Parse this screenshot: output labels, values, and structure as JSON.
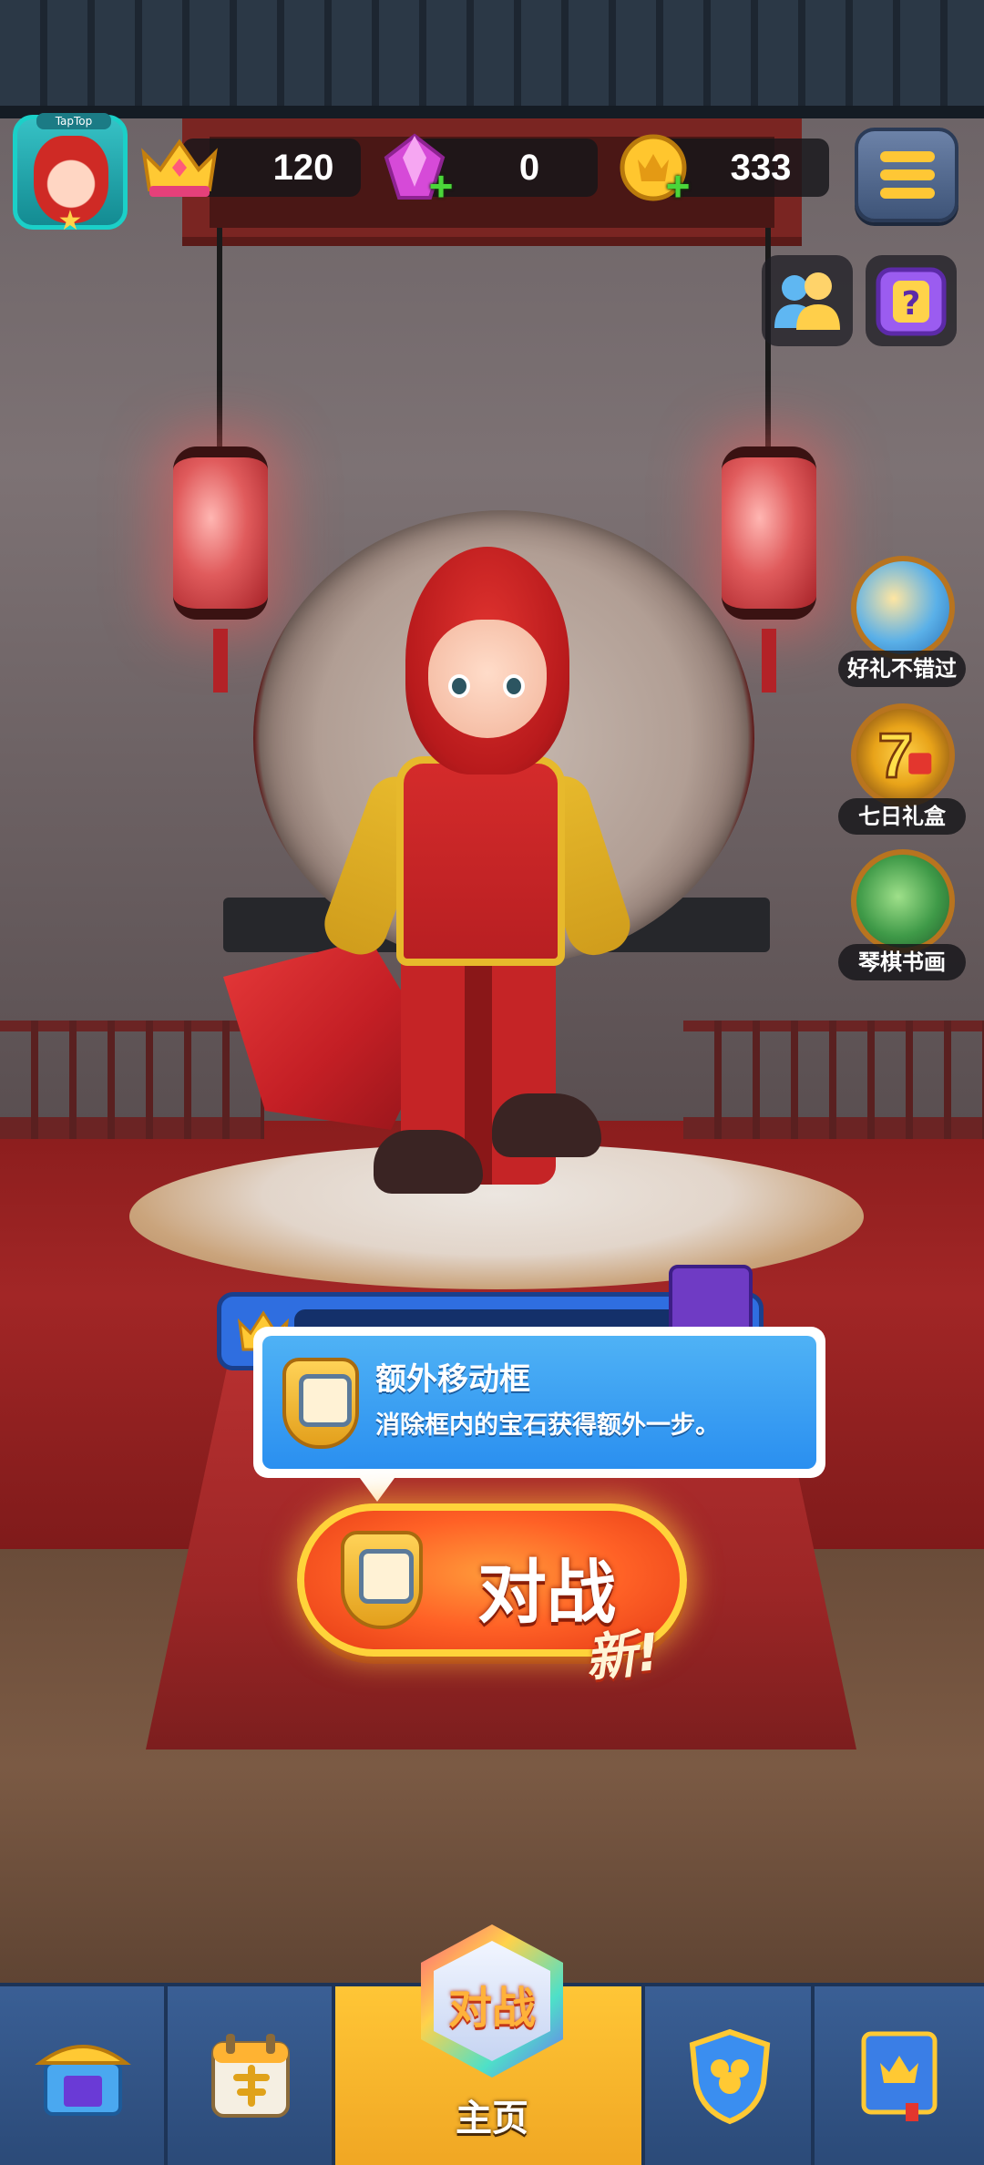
{
  "top_bar": {
    "avatar_tag": "TapTop",
    "crowns": "120",
    "gems": "0",
    "coins": "333"
  },
  "side_events": [
    {
      "label": "好礼不错过",
      "icon": "megaphone-gift-icon"
    },
    {
      "label": "七日礼盒",
      "icon": "seven-day-gift-icon"
    },
    {
      "label": "琴棋书画",
      "icon": "chess-painting-icon"
    }
  ],
  "tooltip": {
    "title": "额外移动框",
    "description": "消除框内的宝石获得额外一步。"
  },
  "battle": {
    "label": "对战",
    "new_badge": "新!"
  },
  "bottom_nav": {
    "home_badge": "对战",
    "home_label": "主页",
    "tabs": [
      {
        "name": "shop",
        "icon": "shop-icon"
      },
      {
        "name": "events",
        "icon": "calendar-icon"
      },
      {
        "name": "home",
        "icon": "battle-badge-icon"
      },
      {
        "name": "team",
        "icon": "team-shield-icon"
      },
      {
        "name": "collection",
        "icon": "crown-book-icon"
      }
    ]
  },
  "colors": {
    "accent_gold": "#ffc636",
    "tooltip_blue": "#2a8ff0",
    "battle_orange": "#ff6126"
  }
}
